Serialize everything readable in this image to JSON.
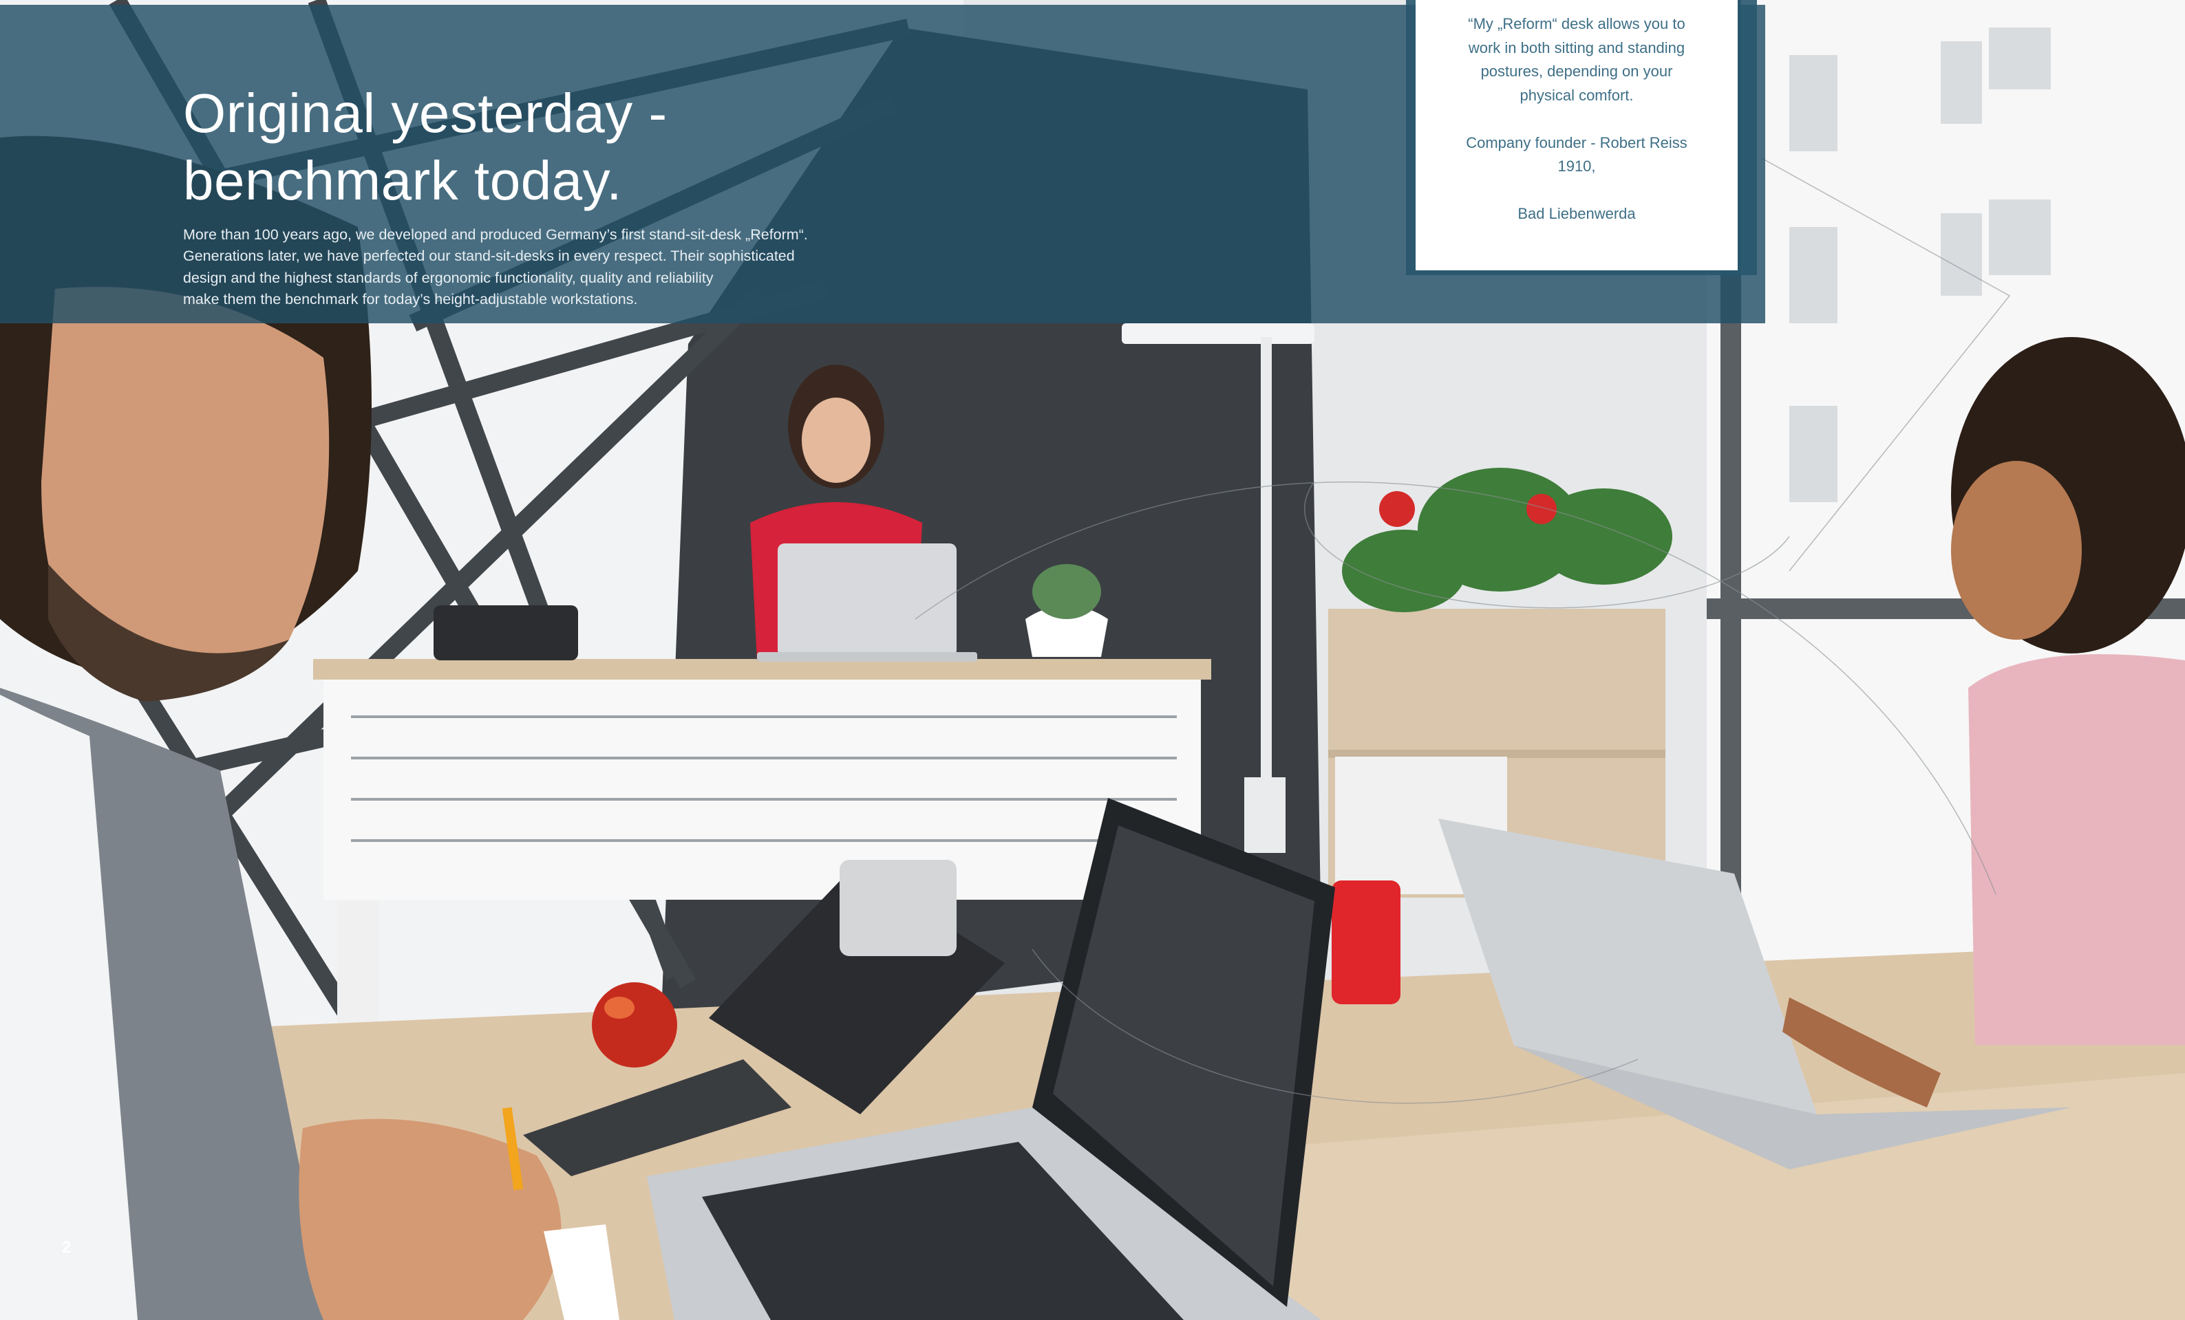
{
  "headline": {
    "line1": "Original yesterday -",
    "line2": "benchmark today."
  },
  "intro": {
    "lines": [
      "More than 100 years ago, we developed and produced Germany’s first stand-sit-desk „Reform“.",
      "Generations later, we have perfected our stand-sit-desks in every respect. Their sophisticated",
      "design and the highest standards of ergonomic functionality, quality and reliability",
      "make them the benchmark for today’s height-adjustable workstations."
    ]
  },
  "quote": {
    "lines": [
      "“My „Reform“ desk allows you to",
      "work in both sitting and standing",
      "postures, depending on your",
      "physical comfort."
    ],
    "attribution_lines": [
      "Company founder - Robert Reiss",
      "1910,"
    ],
    "location": "Bad Liebenwerda"
  },
  "page_number": "2",
  "colors": {
    "banner": "#224f67",
    "quote_text": "#3e6f87",
    "headline": "#ffffff"
  },
  "photo": {
    "subject": "office-photo-people-at-height-adjustable-desks-with-laptops"
  }
}
